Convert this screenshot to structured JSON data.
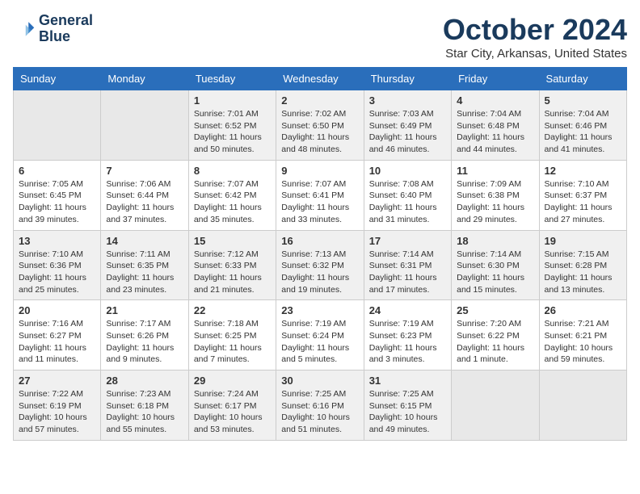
{
  "header": {
    "logo_line1": "General",
    "logo_line2": "Blue",
    "month_title": "October 2024",
    "location": "Star City, Arkansas, United States"
  },
  "weekdays": [
    "Sunday",
    "Monday",
    "Tuesday",
    "Wednesday",
    "Thursday",
    "Friday",
    "Saturday"
  ],
  "weeks": [
    [
      {
        "day": "",
        "empty": true
      },
      {
        "day": "",
        "empty": true
      },
      {
        "day": "1",
        "sunrise": "Sunrise: 7:01 AM",
        "sunset": "Sunset: 6:52 PM",
        "daylight": "Daylight: 11 hours and 50 minutes."
      },
      {
        "day": "2",
        "sunrise": "Sunrise: 7:02 AM",
        "sunset": "Sunset: 6:50 PM",
        "daylight": "Daylight: 11 hours and 48 minutes."
      },
      {
        "day": "3",
        "sunrise": "Sunrise: 7:03 AM",
        "sunset": "Sunset: 6:49 PM",
        "daylight": "Daylight: 11 hours and 46 minutes."
      },
      {
        "day": "4",
        "sunrise": "Sunrise: 7:04 AM",
        "sunset": "Sunset: 6:48 PM",
        "daylight": "Daylight: 11 hours and 44 minutes."
      },
      {
        "day": "5",
        "sunrise": "Sunrise: 7:04 AM",
        "sunset": "Sunset: 6:46 PM",
        "daylight": "Daylight: 11 hours and 41 minutes."
      }
    ],
    [
      {
        "day": "6",
        "sunrise": "Sunrise: 7:05 AM",
        "sunset": "Sunset: 6:45 PM",
        "daylight": "Daylight: 11 hours and 39 minutes."
      },
      {
        "day": "7",
        "sunrise": "Sunrise: 7:06 AM",
        "sunset": "Sunset: 6:44 PM",
        "daylight": "Daylight: 11 hours and 37 minutes."
      },
      {
        "day": "8",
        "sunrise": "Sunrise: 7:07 AM",
        "sunset": "Sunset: 6:42 PM",
        "daylight": "Daylight: 11 hours and 35 minutes."
      },
      {
        "day": "9",
        "sunrise": "Sunrise: 7:07 AM",
        "sunset": "Sunset: 6:41 PM",
        "daylight": "Daylight: 11 hours and 33 minutes."
      },
      {
        "day": "10",
        "sunrise": "Sunrise: 7:08 AM",
        "sunset": "Sunset: 6:40 PM",
        "daylight": "Daylight: 11 hours and 31 minutes."
      },
      {
        "day": "11",
        "sunrise": "Sunrise: 7:09 AM",
        "sunset": "Sunset: 6:38 PM",
        "daylight": "Daylight: 11 hours and 29 minutes."
      },
      {
        "day": "12",
        "sunrise": "Sunrise: 7:10 AM",
        "sunset": "Sunset: 6:37 PM",
        "daylight": "Daylight: 11 hours and 27 minutes."
      }
    ],
    [
      {
        "day": "13",
        "sunrise": "Sunrise: 7:10 AM",
        "sunset": "Sunset: 6:36 PM",
        "daylight": "Daylight: 11 hours and 25 minutes."
      },
      {
        "day": "14",
        "sunrise": "Sunrise: 7:11 AM",
        "sunset": "Sunset: 6:35 PM",
        "daylight": "Daylight: 11 hours and 23 minutes."
      },
      {
        "day": "15",
        "sunrise": "Sunrise: 7:12 AM",
        "sunset": "Sunset: 6:33 PM",
        "daylight": "Daylight: 11 hours and 21 minutes."
      },
      {
        "day": "16",
        "sunrise": "Sunrise: 7:13 AM",
        "sunset": "Sunset: 6:32 PM",
        "daylight": "Daylight: 11 hours and 19 minutes."
      },
      {
        "day": "17",
        "sunrise": "Sunrise: 7:14 AM",
        "sunset": "Sunset: 6:31 PM",
        "daylight": "Daylight: 11 hours and 17 minutes."
      },
      {
        "day": "18",
        "sunrise": "Sunrise: 7:14 AM",
        "sunset": "Sunset: 6:30 PM",
        "daylight": "Daylight: 11 hours and 15 minutes."
      },
      {
        "day": "19",
        "sunrise": "Sunrise: 7:15 AM",
        "sunset": "Sunset: 6:28 PM",
        "daylight": "Daylight: 11 hours and 13 minutes."
      }
    ],
    [
      {
        "day": "20",
        "sunrise": "Sunrise: 7:16 AM",
        "sunset": "Sunset: 6:27 PM",
        "daylight": "Daylight: 11 hours and 11 minutes."
      },
      {
        "day": "21",
        "sunrise": "Sunrise: 7:17 AM",
        "sunset": "Sunset: 6:26 PM",
        "daylight": "Daylight: 11 hours and 9 minutes."
      },
      {
        "day": "22",
        "sunrise": "Sunrise: 7:18 AM",
        "sunset": "Sunset: 6:25 PM",
        "daylight": "Daylight: 11 hours and 7 minutes."
      },
      {
        "day": "23",
        "sunrise": "Sunrise: 7:19 AM",
        "sunset": "Sunset: 6:24 PM",
        "daylight": "Daylight: 11 hours and 5 minutes."
      },
      {
        "day": "24",
        "sunrise": "Sunrise: 7:19 AM",
        "sunset": "Sunset: 6:23 PM",
        "daylight": "Daylight: 11 hours and 3 minutes."
      },
      {
        "day": "25",
        "sunrise": "Sunrise: 7:20 AM",
        "sunset": "Sunset: 6:22 PM",
        "daylight": "Daylight: 11 hours and 1 minute."
      },
      {
        "day": "26",
        "sunrise": "Sunrise: 7:21 AM",
        "sunset": "Sunset: 6:21 PM",
        "daylight": "Daylight: 10 hours and 59 minutes."
      }
    ],
    [
      {
        "day": "27",
        "sunrise": "Sunrise: 7:22 AM",
        "sunset": "Sunset: 6:19 PM",
        "daylight": "Daylight: 10 hours and 57 minutes."
      },
      {
        "day": "28",
        "sunrise": "Sunrise: 7:23 AM",
        "sunset": "Sunset: 6:18 PM",
        "daylight": "Daylight: 10 hours and 55 minutes."
      },
      {
        "day": "29",
        "sunrise": "Sunrise: 7:24 AM",
        "sunset": "Sunset: 6:17 PM",
        "daylight": "Daylight: 10 hours and 53 minutes."
      },
      {
        "day": "30",
        "sunrise": "Sunrise: 7:25 AM",
        "sunset": "Sunset: 6:16 PM",
        "daylight": "Daylight: 10 hours and 51 minutes."
      },
      {
        "day": "31",
        "sunrise": "Sunrise: 7:25 AM",
        "sunset": "Sunset: 6:15 PM",
        "daylight": "Daylight: 10 hours and 49 minutes."
      },
      {
        "day": "",
        "empty": true
      },
      {
        "day": "",
        "empty": true
      }
    ]
  ]
}
